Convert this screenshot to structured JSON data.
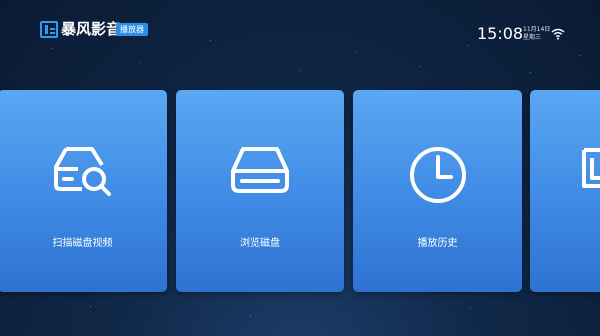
{
  "header": {
    "app_title": "暴风影音",
    "badge": "播放器",
    "time": "15:08",
    "date": "11月14日",
    "weekday": "星期三"
  },
  "tiles": [
    {
      "label": "扫描磁盘视频",
      "icon": "scan-disk-icon"
    },
    {
      "label": "浏览磁盘",
      "icon": "disk-drive-icon"
    },
    {
      "label": "播放历史",
      "icon": "clock-icon"
    },
    {
      "label": "",
      "icon": "screen-icon"
    }
  ],
  "colors": {
    "tile": "#4a96ea",
    "background": "#0f2446",
    "accent": "#2b8fe3"
  }
}
